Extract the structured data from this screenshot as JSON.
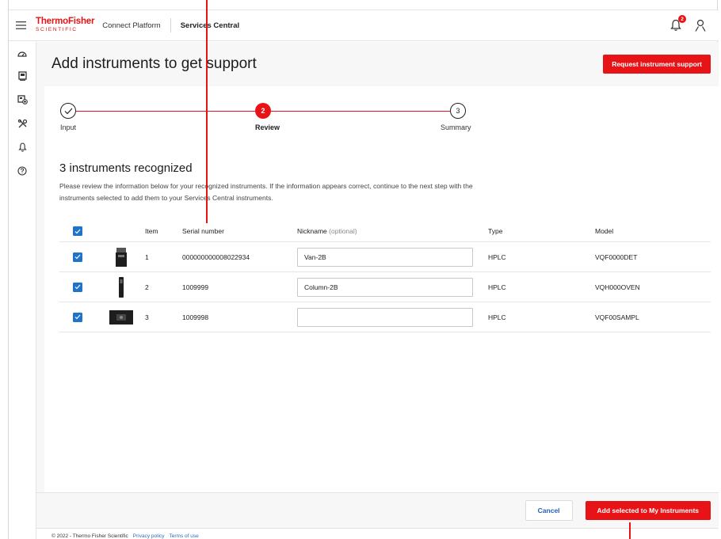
{
  "topbar": {
    "brand_line1": "ThermoFisher",
    "brand_line2": "SCIENTIFIC",
    "product": "Connect Platform",
    "app": "Services Central",
    "notification_count": "2"
  },
  "sidenav": {
    "items": [
      "dashboard-icon",
      "instrument-icon",
      "add-instrument-icon",
      "tools-icon",
      "bell-icon",
      "help-icon"
    ]
  },
  "page": {
    "title": "Add instruments to get support",
    "request_button": "Request instrument support"
  },
  "stepper": {
    "steps": [
      {
        "label": "Input",
        "number": "1",
        "state": "done"
      },
      {
        "label": "Review",
        "number": "2",
        "state": "active"
      },
      {
        "label": "Summary",
        "number": "3",
        "state": "todo"
      }
    ]
  },
  "recognized": {
    "title": "3 instruments recognized",
    "description": "Please review the information below for your recognized instruments. If the information appears correct, continue to the next step with the instruments selected to add them to your Services Central instruments."
  },
  "table": {
    "headers": {
      "item": "Item",
      "serial": "Serial number",
      "nickname": "Nickname",
      "nickname_hint": "(optional)",
      "type": "Type",
      "model": "Model"
    },
    "rows": [
      {
        "checked": true,
        "item": "1",
        "serial": "000000000008022934",
        "nickname": "Van-2B",
        "type": "HPLC",
        "model": "VQF0000DET"
      },
      {
        "checked": true,
        "item": "2",
        "serial": "1009999",
        "nickname": "Column-2B",
        "type": "HPLC",
        "model": "VQH000OVEN"
      },
      {
        "checked": true,
        "item": "3",
        "serial": "1009998",
        "nickname": "",
        "type": "HPLC",
        "model": "VQF00SAMPL"
      }
    ]
  },
  "footer": {
    "cancel": "Cancel",
    "add_selected": "Add selected to My Instruments",
    "copyright": "© 2022 - Thermo Fisher Scientific",
    "privacy": "Privacy policy",
    "terms": "Terms of use"
  },
  "colors": {
    "brand_red": "#e71316",
    "checkbox_blue": "#1f73c9"
  }
}
